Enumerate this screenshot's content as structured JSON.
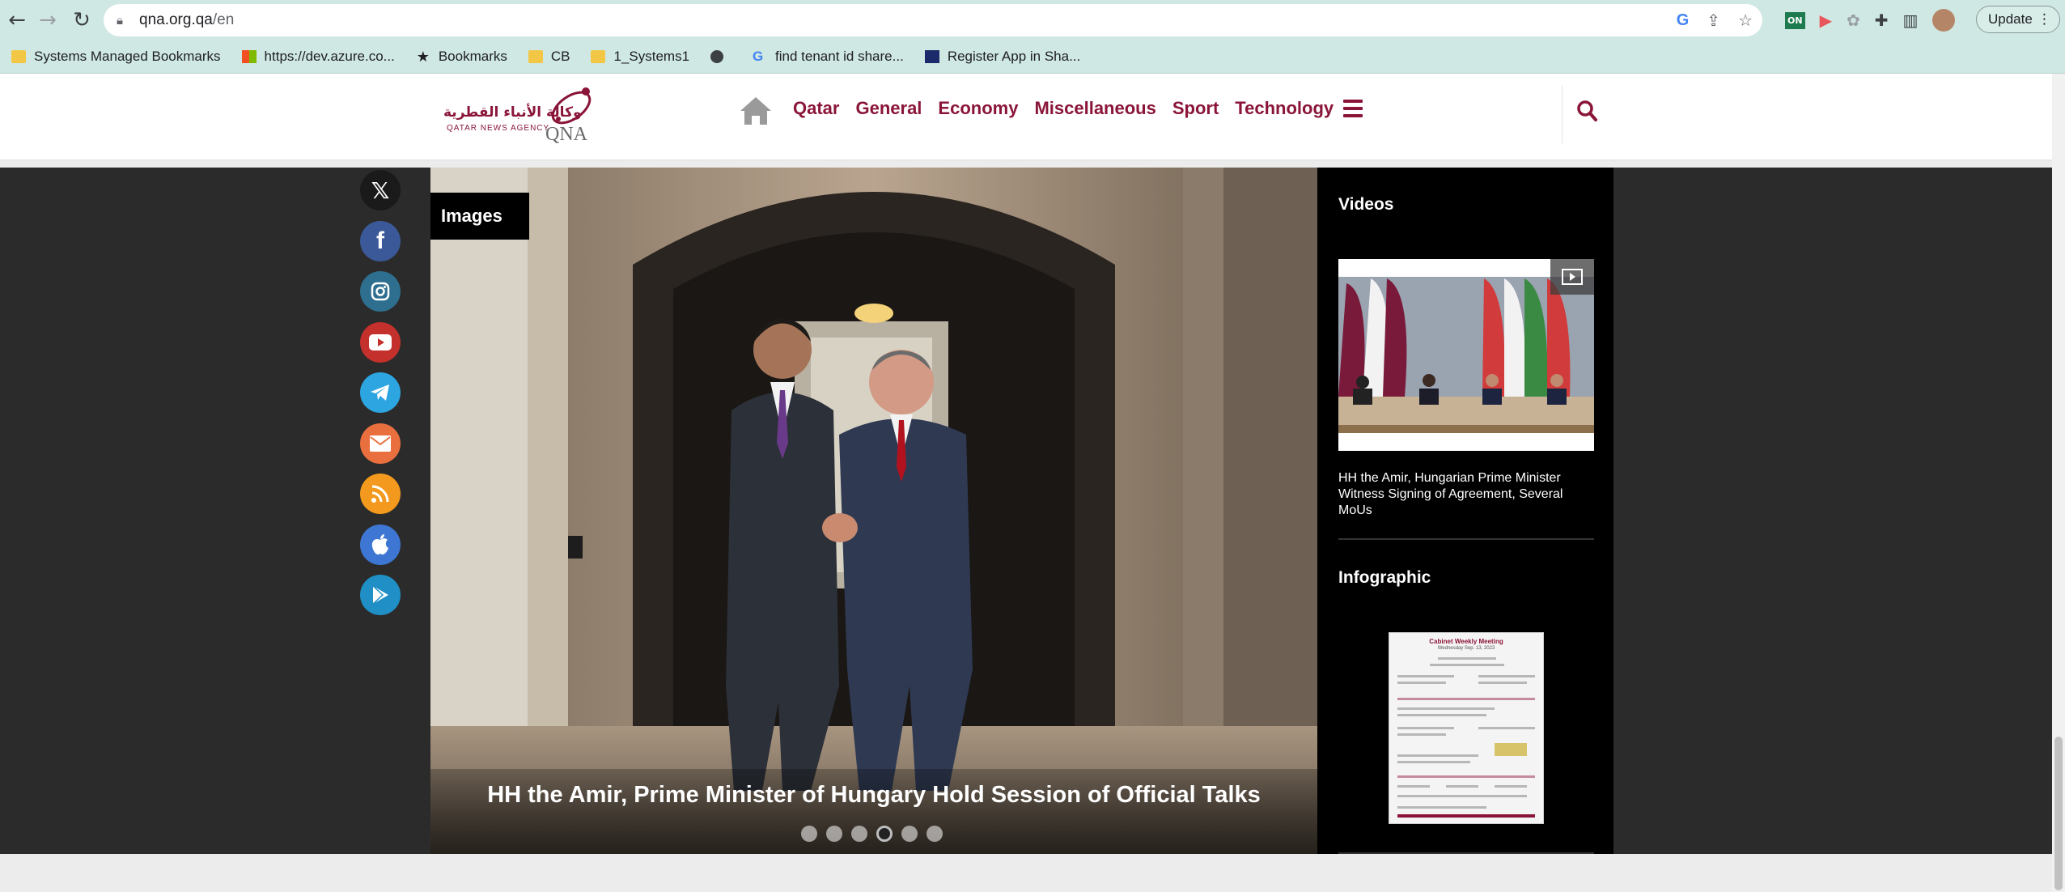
{
  "browser": {
    "url_host": "qna.org.qa",
    "url_path": "/en",
    "update_label": "Update",
    "bookmarks": [
      {
        "label": "Systems Managed Bookmarks",
        "icon": "folder-icon"
      },
      {
        "label": "https://dev.azure.co...",
        "icon": "microsoft-icon"
      },
      {
        "label": "Bookmarks",
        "icon": "star-icon"
      },
      {
        "label": "CB",
        "icon": "folder-icon"
      },
      {
        "label": "1_Systems1",
        "icon": "folder-icon"
      },
      {
        "label": "",
        "icon": "globe-icon"
      },
      {
        "label": "find tenant id share...",
        "icon": "google-icon"
      },
      {
        "label": "Register App in Sha...",
        "icon": "app-icon"
      }
    ]
  },
  "site": {
    "logo_arabic": "وكالة الأنباء القطرية",
    "logo_english": "QATAR NEWS AGENCY",
    "logo_mark": "QNA",
    "nav": [
      "Qatar",
      "General",
      "Economy",
      "Miscellaneous",
      "Sport",
      "Technology"
    ],
    "accent_color": "#8a1538"
  },
  "social": [
    "x-icon",
    "facebook-icon",
    "instagram-icon",
    "youtube-icon",
    "telegram-icon",
    "email-icon",
    "rss-icon",
    "apple-icon",
    "google-play-icon"
  ],
  "slider": {
    "badge": "Images",
    "caption": "HH the Amir, Prime Minister of Hungary Hold Session of Official Talks",
    "dots_total": 6,
    "active_dot": 4
  },
  "sidebar": {
    "videos_title": "Videos",
    "video_caption": "HH the Amir, Hungarian Prime Minister Witness Signing of Agreement, Several MoUs",
    "infographic_title": "Infographic",
    "infographic_heading": "Cabinet Weekly Meeting",
    "infographic_date": "Wednesday Sep. 13, 2023"
  }
}
